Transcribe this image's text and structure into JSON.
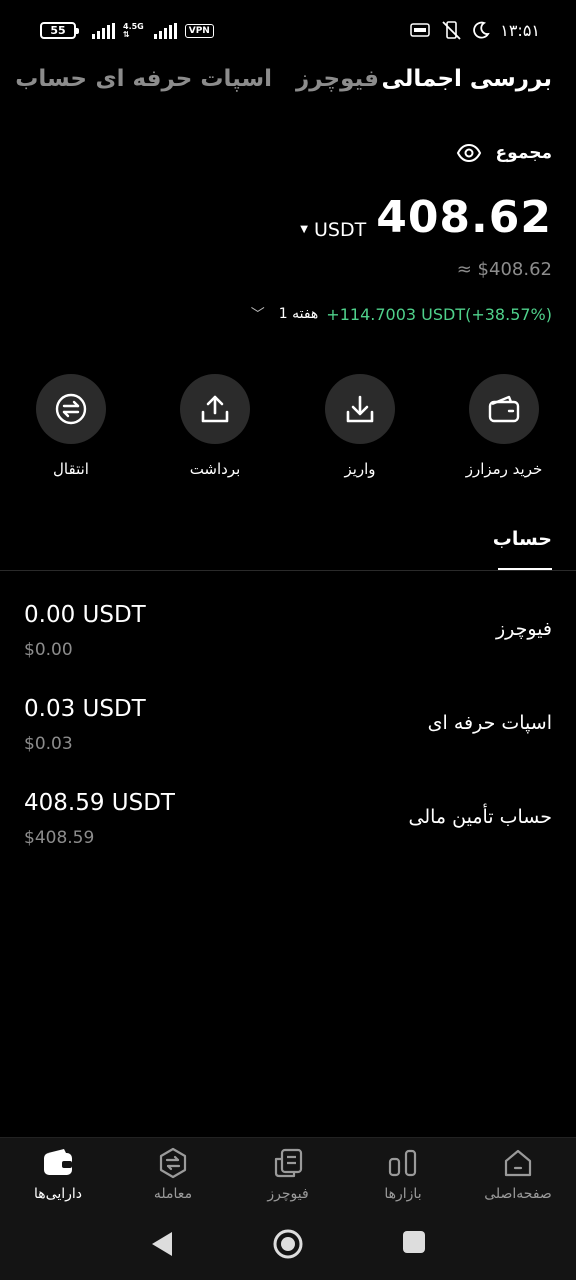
{
  "status_bar": {
    "battery": "55",
    "network": "4.5G",
    "vpn": "VPN",
    "time": "۱۳:۵۱"
  },
  "tabs": [
    {
      "label": "بررسی اجمالی",
      "active": true
    },
    {
      "label": "فیوچرز",
      "active": false
    },
    {
      "label": "اسپات حرفه ای",
      "active": false
    },
    {
      "label": "حساب",
      "active": false
    }
  ],
  "total": {
    "label": "مجموع",
    "balance": "408.62",
    "unit": "USDT",
    "approx": "≈ $408.62",
    "pnl": "+114.7003 USDT(+38.57%)",
    "period": "1 هفته"
  },
  "actions": [
    {
      "label": "خرید رمزارز",
      "icon": "wallet-icon"
    },
    {
      "label": "واریز",
      "icon": "deposit-icon"
    },
    {
      "label": "برداشت",
      "icon": "withdraw-icon"
    },
    {
      "label": "انتقال",
      "icon": "transfer-icon"
    }
  ],
  "section": {
    "label": "حساب"
  },
  "accounts": [
    {
      "name": "فیوچرز",
      "amount": "0.00 USDT",
      "usd": "$0.00"
    },
    {
      "name": "اسپات حرفه ای",
      "amount": "0.03 USDT",
      "usd": "$0.03"
    },
    {
      "name": "حساب تأمین مالی",
      "amount": "408.59 USDT",
      "usd": "$408.59"
    }
  ],
  "bottom_nav": [
    {
      "label": "صفحه‌اصلی",
      "icon": "home-icon",
      "active": false
    },
    {
      "label": "بازارها",
      "icon": "markets-icon",
      "active": false
    },
    {
      "label": "فیوچرز",
      "icon": "futures-icon",
      "active": false
    },
    {
      "label": "معامله",
      "icon": "trade-icon",
      "active": false
    },
    {
      "label": "دارایی‌ها",
      "icon": "assets-icon",
      "active": true
    }
  ],
  "colors": {
    "background": "#000000",
    "positive": "#4fd18b",
    "muted": "#8c8c8c",
    "action_circle": "#2b2b2b",
    "nav_bg": "#141414"
  }
}
